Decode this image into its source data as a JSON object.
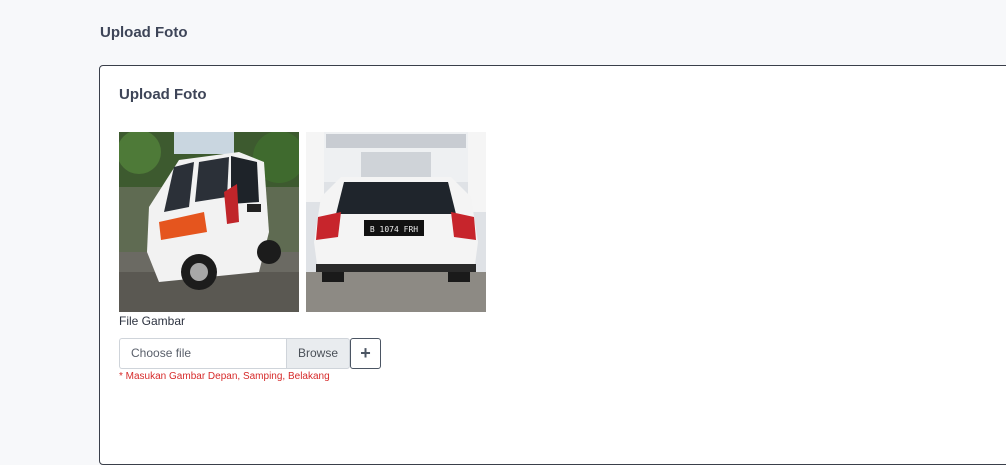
{
  "page": {
    "title": "Upload Foto"
  },
  "card": {
    "title": "Upload Foto",
    "photos": [
      {
        "name": "photo-side-view"
      },
      {
        "name": "photo-rear-view"
      }
    ],
    "plate_text": "B 1074 FRH",
    "file_label": "File Gambar",
    "file_input_placeholder": "Choose file",
    "browse_label": "Browse",
    "add_icon": "plus-icon",
    "hint": "* Masukan Gambar Depan, Samping, Belakang"
  },
  "colors": {
    "background": "#f7f8fa",
    "card_border": "#3a3f4a",
    "hint": "#d62b2b"
  }
}
